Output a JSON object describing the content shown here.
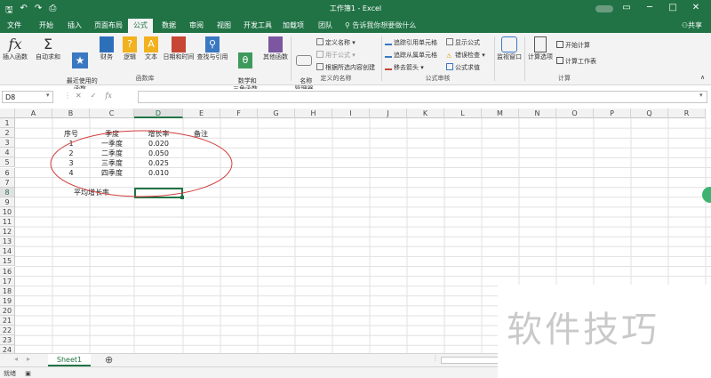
{
  "window": {
    "title": "工作簿1 - Excel",
    "share": "共享"
  },
  "tabs": [
    "文件",
    "开始",
    "插入",
    "页面布局",
    "公式",
    "数据",
    "审阅",
    "视图",
    "开发工具",
    "加载项",
    "团队"
  ],
  "tell_me": "告诉我你想要做什么",
  "ribbon": {
    "insert_function": "插入函数",
    "autosum": "自动求和",
    "recent": "最近使用的\n函数",
    "financial": "财务",
    "logical": "逻辑",
    "text": "文本",
    "datetime": "日期和时间",
    "lookup": "查找与引用",
    "math": "数学和\n三角函数",
    "other": "其他函数",
    "group_library": "函数库",
    "name_manager": "名称\n管理器",
    "define_name": "定义名称",
    "use_in_formula": "用于公式",
    "create_from_selection": "根据所选内容创建",
    "group_names": "定义的名称",
    "trace_precedents": "追踪引用单元格",
    "trace_dependents": "追踪从属单元格",
    "remove_arrows": "移去箭头",
    "show_formulas": "显示公式",
    "error_checking": "错误检查",
    "evaluate_formula": "公式求值",
    "group_audit": "公式审核",
    "watch_window": "监视窗口",
    "calc_options": "计算选项",
    "calc_now": "开始计算",
    "calc_sheet": "计算工作表",
    "group_calc": "计算"
  },
  "formula_bar": {
    "name_box": "D8",
    "fx": "fx",
    "cancel": "✕",
    "enter": "✓",
    "value": ""
  },
  "columns": [
    "A",
    "B",
    "C",
    "D",
    "E",
    "F",
    "G",
    "H",
    "I",
    "J",
    "K",
    "L",
    "M",
    "N",
    "O",
    "P",
    "Q",
    "R"
  ],
  "rows": [
    "1",
    "2",
    "3",
    "4",
    "5",
    "6",
    "7",
    "8",
    "9",
    "10",
    "11",
    "12",
    "13",
    "14",
    "15",
    "16",
    "17",
    "18",
    "19",
    "20",
    "21",
    "22",
    "23",
    "24"
  ],
  "cells": {
    "B2": "序号",
    "C2": "季度",
    "D2": "增长率",
    "E2": "备注",
    "B3": "1",
    "C3": "一季度",
    "D3": "0.020",
    "B4": "2",
    "C4": "二季度",
    "D4": "0.050",
    "B5": "3",
    "C5": "三季度",
    "D5": "0.025",
    "B6": "4",
    "C6": "四季度",
    "D6": "0.010",
    "B8": "平均增长率"
  },
  "sheet": {
    "name": "Sheet1",
    "add": "⊕"
  },
  "status": {
    "ready": "就绪"
  },
  "watermark": "软件技巧",
  "colors": {
    "brand": "#217346",
    "annotation": "#d23b3b"
  }
}
